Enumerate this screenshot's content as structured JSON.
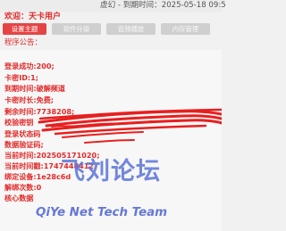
{
  "header": {
    "title": "虚幻 - 到期时间：2025-05-18 09:5"
  },
  "welcome": "欢迎：天卡用户",
  "tabs": [
    {
      "label": "设置主题"
    },
    {
      "label": "软件升级"
    },
    {
      "label": "音频播放"
    },
    {
      "label": "内存管理"
    }
  ],
  "notice_label": "程序公告：",
  "info": [
    "登录成功:200;",
    "卡密ID:1;",
    "到期时间:破解频道",
    "卡密时长:免费;",
    "剩余时间:7738208;",
    "校验密钥",
    "登录状态码",
    "数据验证码;",
    "当前时间:202505171020;",
    "当前时间戳:1747448412",
    "绑定设备:1e28c6d",
    "解绑次数:0",
    "核心数据"
  ],
  "watermark": {
    "chinese": "飞刘论坛",
    "english": "QiYe Net Tech Team"
  },
  "colors": {
    "accent_red": "#e22a2a",
    "tab_active": "#e54444",
    "tab_inactive": "#cfcfcf",
    "watermark_blue": "#5a73d7"
  }
}
